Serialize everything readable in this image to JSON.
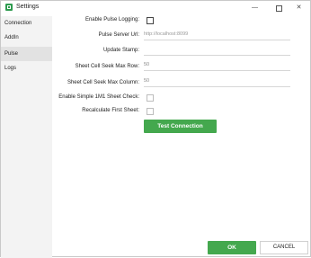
{
  "window": {
    "title": "Settings",
    "controls": {
      "minimize": "—",
      "close": "✕"
    }
  },
  "sidebar": {
    "items": [
      {
        "label": "Connection",
        "selected": false
      },
      {
        "label": "AddIn",
        "selected": false
      },
      {
        "label": "Pulse",
        "selected": true
      },
      {
        "label": "Logs",
        "selected": false
      }
    ]
  },
  "form": {
    "enable_pulse_logging": {
      "label": "Enable Pulse Logging:",
      "checked": false
    },
    "pulse_server_url": {
      "label": "Pulse Server Url:",
      "value": "http://localhost:8099"
    },
    "update_stamp": {
      "label": "Update Stamp:",
      "value": ""
    },
    "seek_max_row": {
      "label": "Sheet Cell Seek Max Row:",
      "value": "50"
    },
    "seek_max_column": {
      "label": "Sheet Cell Seek Max Column:",
      "value": "50"
    },
    "enable_simple_sheet_check": {
      "label": "Enable Simple 1M1 Sheet Check:",
      "checked": false
    },
    "recalculate_first_sheet": {
      "label": "Recalculate First Sheet:",
      "checked": false
    },
    "test_connection": "Test Connection"
  },
  "footer": {
    "ok": "OK",
    "cancel": "CANCEL"
  },
  "colors": {
    "accent": "#44a84e",
    "sidebar_bg": "#f3f3f3",
    "selected_bg": "#e2e2e2"
  }
}
